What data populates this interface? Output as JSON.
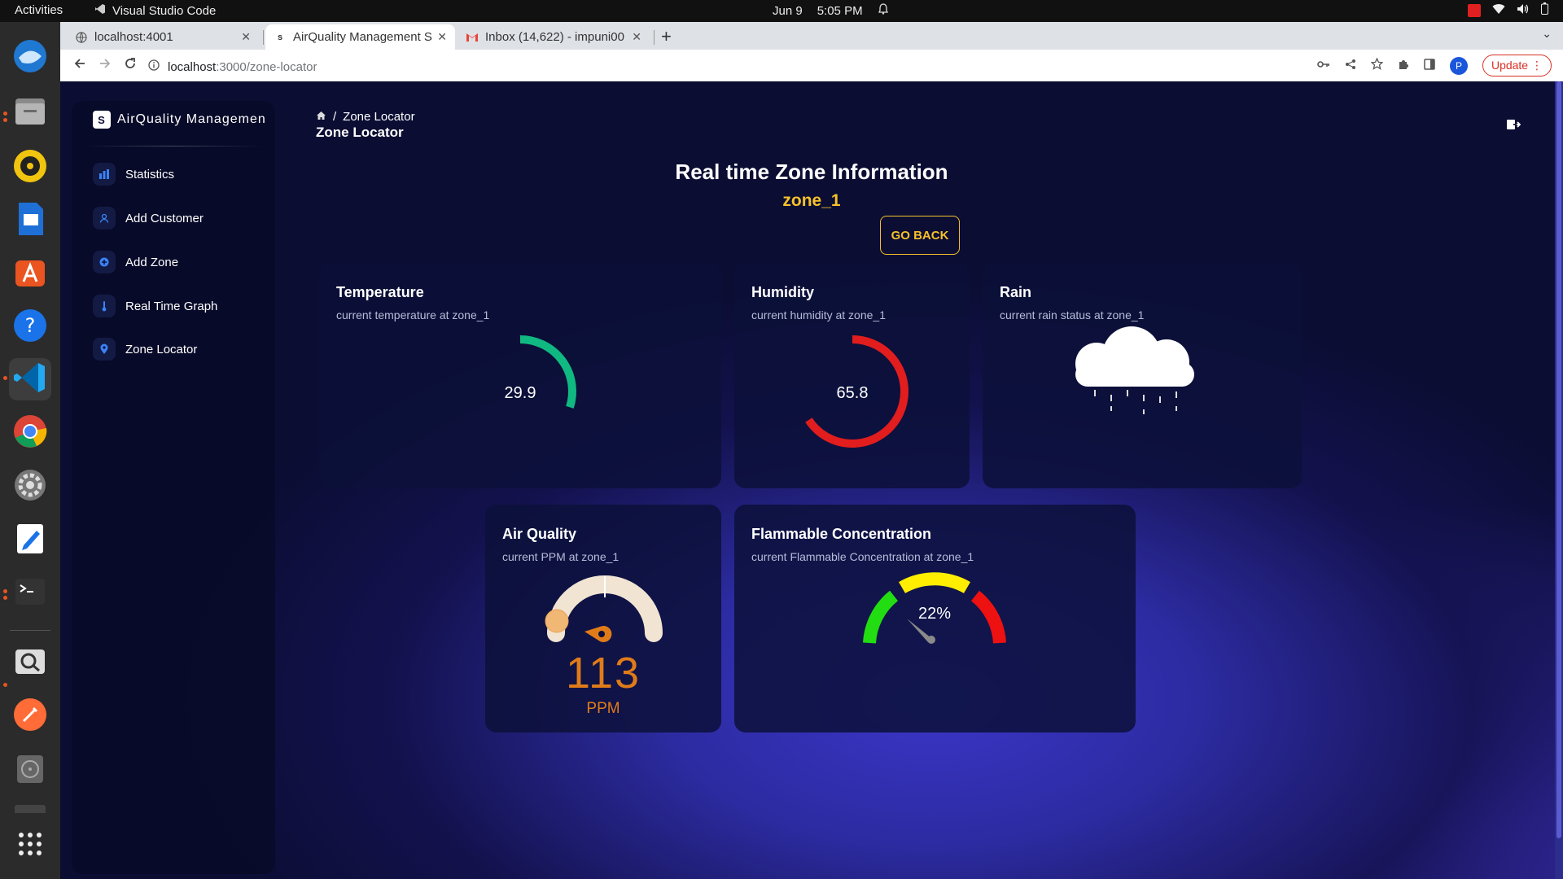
{
  "system": {
    "activities": "Activities",
    "app_name": "Visual Studio Code",
    "date": "Jun 9",
    "time": "5:05 PM"
  },
  "browser": {
    "tabs": [
      {
        "title": "localhost:4001",
        "active": false
      },
      {
        "title": "AirQuality Management S",
        "active": true
      },
      {
        "title": "Inbox (14,622) - impuni00",
        "active": false
      }
    ],
    "url_host": "localhost",
    "url_path": ":3000/zone-locator",
    "profile_initial": "P",
    "update_label": "Update"
  },
  "sidebar": {
    "brand": "AirQuality Managemen",
    "brand_logo": "S",
    "items": [
      {
        "label": "Statistics",
        "icon": "bar-chart-icon"
      },
      {
        "label": "Add Customer",
        "icon": "user-icon"
      },
      {
        "label": "Add Zone",
        "icon": "plus-circle-icon"
      },
      {
        "label": "Real Time Graph",
        "icon": "thermometer-icon"
      },
      {
        "label": "Zone Locator",
        "icon": "map-pin-icon"
      }
    ]
  },
  "header": {
    "breadcrumb_current": "Zone Locator",
    "page_title": "Zone Locator"
  },
  "main": {
    "title": "Real time Zone Information",
    "zone": "zone_1",
    "go_back": "GO BACK"
  },
  "cards": {
    "temperature": {
      "title": "Temperature",
      "subtitle": "current temperature at zone_1",
      "value": "29.9",
      "fraction": 0.299,
      "color": "#10b981"
    },
    "humidity": {
      "title": "Humidity",
      "subtitle": "current humidity at zone_1",
      "value": "65.8",
      "fraction": 0.658,
      "color": "#e11d1d"
    },
    "rain": {
      "title": "Rain",
      "subtitle": "current rain status at zone_1"
    },
    "air_quality": {
      "title": "Air Quality",
      "subtitle": "current PPM at zone_1",
      "value": "113",
      "unit": "PPM",
      "color": "#e07b1a"
    },
    "flammable": {
      "title": "Flammable Concentration",
      "subtitle": "current Flammable Concentration at zone_1",
      "value": "22%"
    }
  },
  "colors": {
    "accent": "#f6c12b",
    "page_bg": "#0b0d33",
    "card_bg": "#0c103a"
  }
}
